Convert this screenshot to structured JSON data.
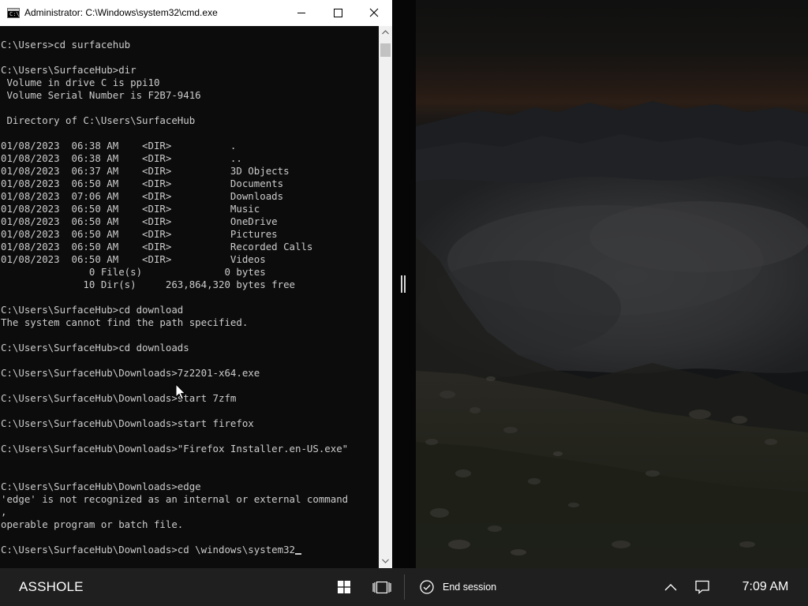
{
  "window": {
    "title": "Administrator: C:\\Windows\\system32\\cmd.exe",
    "icon_label": "C:\\",
    "buttons": {
      "minimize": "minimize-icon",
      "maximize": "maximize-icon",
      "close": "close-icon"
    }
  },
  "console": {
    "lines": [
      "C:\\Users>cd surfacehub",
      "",
      "C:\\Users\\SurfaceHub>dir",
      " Volume in drive C is ppi10",
      " Volume Serial Number is F2B7-9416",
      "",
      " Directory of C:\\Users\\SurfaceHub",
      "",
      "01/08/2023  06:38 AM    <DIR>          .",
      "01/08/2023  06:38 AM    <DIR>          ..",
      "01/08/2023  06:37 AM    <DIR>          3D Objects",
      "01/08/2023  06:50 AM    <DIR>          Documents",
      "01/08/2023  07:06 AM    <DIR>          Downloads",
      "01/08/2023  06:50 AM    <DIR>          Music",
      "01/08/2023  06:50 AM    <DIR>          OneDrive",
      "01/08/2023  06:50 AM    <DIR>          Pictures",
      "01/08/2023  06:50 AM    <DIR>          Recorded Calls",
      "01/08/2023  06:50 AM    <DIR>          Videos",
      "               0 File(s)              0 bytes",
      "              10 Dir(s)     263,864,320 bytes free",
      "",
      "C:\\Users\\SurfaceHub>cd download",
      "The system cannot find the path specified.",
      "",
      "C:\\Users\\SurfaceHub>cd downloads",
      "",
      "C:\\Users\\SurfaceHub\\Downloads>7z2201-x64.exe",
      "",
      "C:\\Users\\SurfaceHub\\Downloads>start 7zfm",
      "",
      "C:\\Users\\SurfaceHub\\Downloads>start firefox",
      "",
      "C:\\Users\\SurfaceHub\\Downloads>\"Firefox Installer.en-US.exe\"",
      "",
      "",
      "C:\\Users\\SurfaceHub\\Downloads>edge",
      "'edge' is not recognized as an internal or external command",
      ",",
      "operable program or batch file.",
      "",
      "C:\\Users\\SurfaceHub\\Downloads>cd \\windows\\system32"
    ],
    "colors": {
      "background": "#0c0c0c",
      "text": "#cccccc"
    }
  },
  "taskbar": {
    "device_name": "ASSHOLE",
    "start_icon": "windows-logo-icon",
    "task_view_icon": "task-view-icon",
    "end_session_label": "End session",
    "end_session_icon": "check-circle-icon",
    "tray_icon": "chevron-up-icon",
    "action_center_icon": "notification-icon",
    "clock": "7:09 AM",
    "colors": {
      "background": "#1f1f1f",
      "text": "#ffffff"
    }
  }
}
